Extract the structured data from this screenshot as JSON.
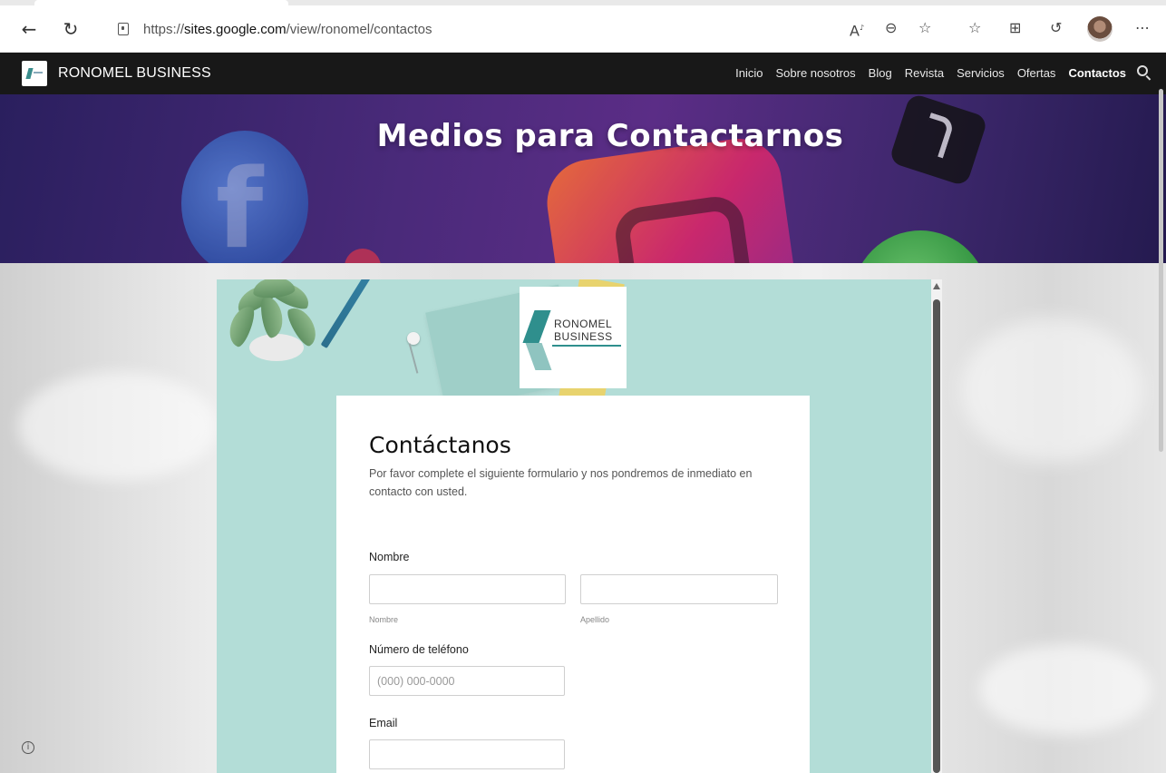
{
  "browser": {
    "url_prefix": "https://",
    "url_host": "sites.google.com",
    "url_path": "/view/ronomel/contactos",
    "icons": [
      "back-arrow-icon",
      "refresh-icon",
      "lock-icon",
      "read-aloud-icon",
      "zoom-icon",
      "favorite-add-icon",
      "favorites-icon",
      "collections-icon",
      "history-icon",
      "profile-avatar",
      "more-icon"
    ]
  },
  "site": {
    "title": "RONOMEL BUSINESS",
    "nav": [
      {
        "label": "Inicio",
        "active": false
      },
      {
        "label": "Sobre nosotros",
        "active": false
      },
      {
        "label": "Blog",
        "active": false
      },
      {
        "label": "Revista",
        "active": false
      },
      {
        "label": "Servicios",
        "active": false
      },
      {
        "label": "Ofertas",
        "active": false
      },
      {
        "label": "Contactos",
        "active": true
      }
    ]
  },
  "hero": {
    "title": "Medios para Contactarnos"
  },
  "embed_logo": {
    "line1": "RONOMEL",
    "line2": "BUSINESS"
  },
  "form": {
    "title": "Contáctanos",
    "description": "Por favor complete el siguiente formulario y nos pondremos de inmediato en contacto con usted.",
    "name_label": "Nombre",
    "first_name_sublabel": "Nombre",
    "last_name_sublabel": "Apellido",
    "first_name_value": "",
    "last_name_value": "",
    "phone_label": "Número de teléfono",
    "phone_placeholder": "(000) 000-0000",
    "email_label": "Email",
    "email_value": ""
  },
  "colors": {
    "nav_bg": "#181818",
    "embed_bg": "#b3ddd7",
    "brand_teal": "#2f8f8d"
  }
}
